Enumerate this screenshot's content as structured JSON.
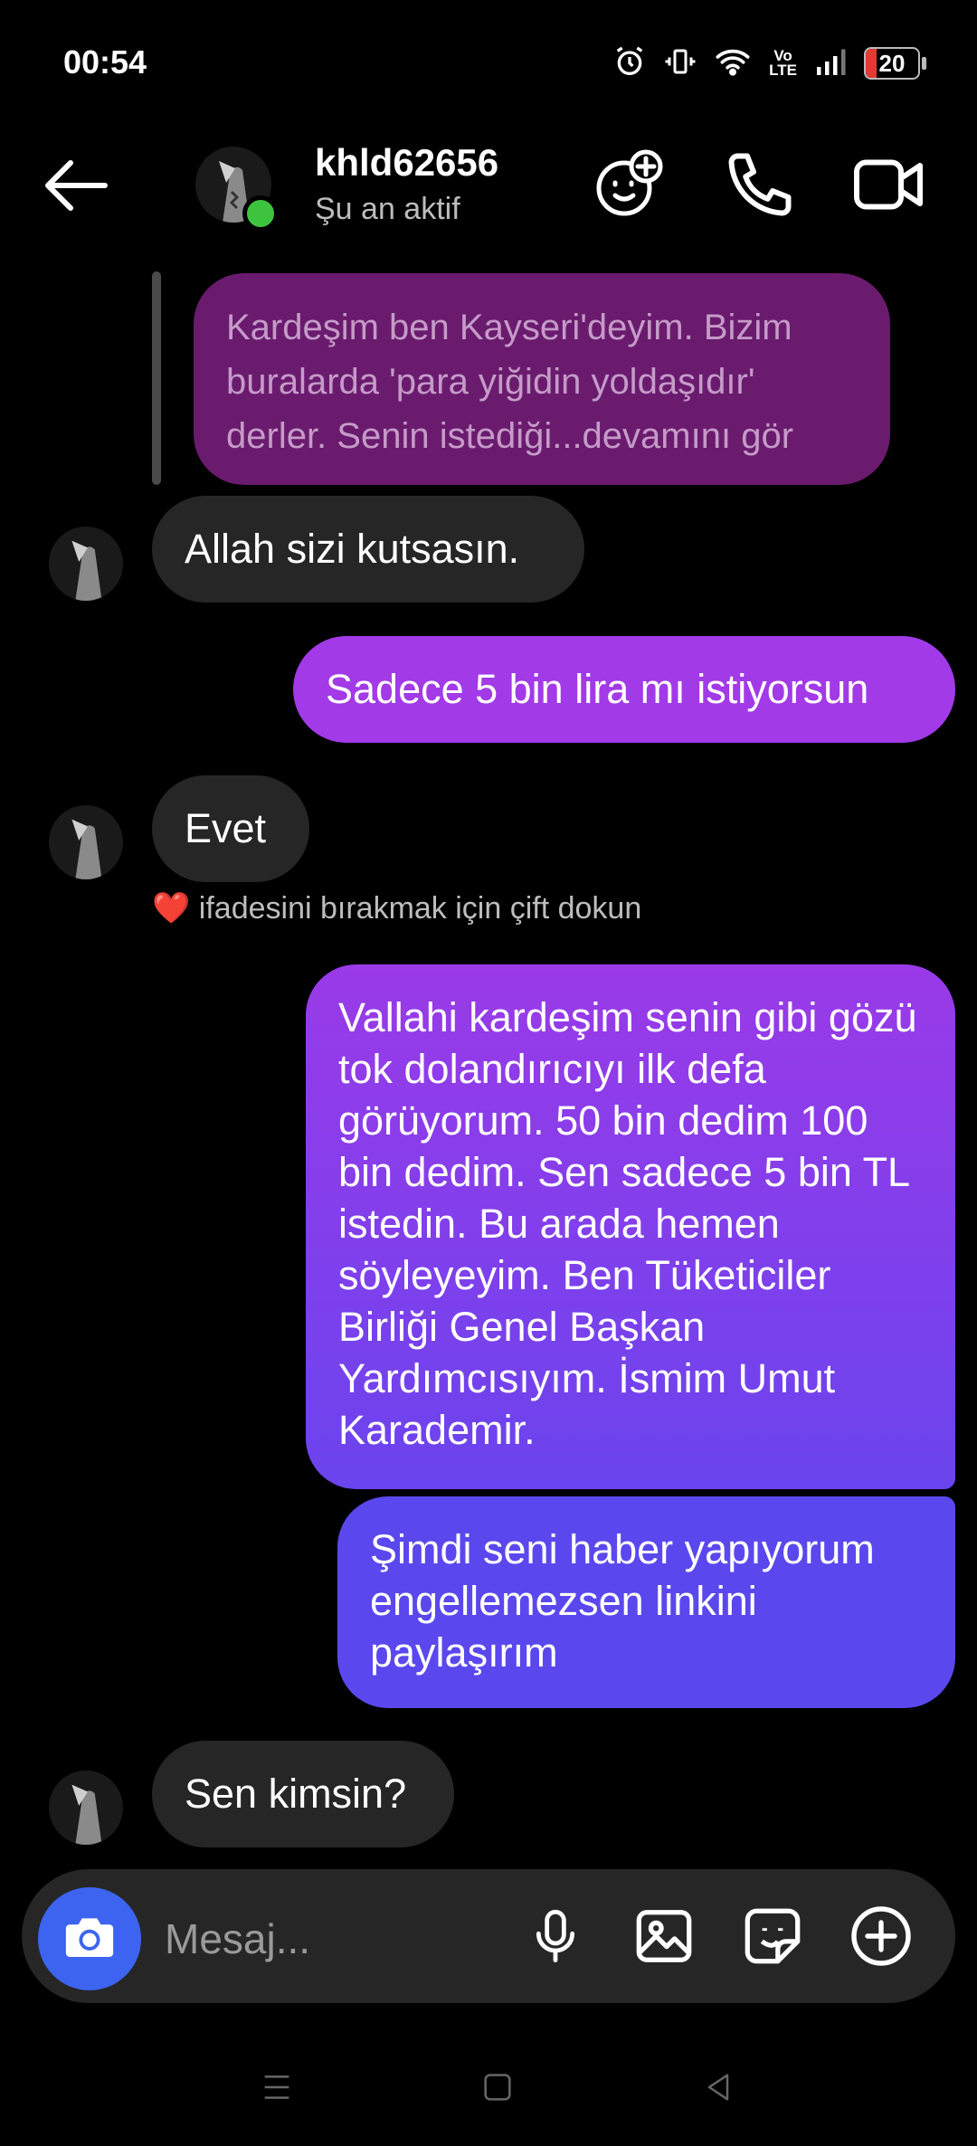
{
  "status_bar": {
    "time": "00:54",
    "network": "Vo\nLTE",
    "battery": "20",
    "battery_color": "#e53935"
  },
  "header": {
    "contact_name": "khld62656",
    "contact_status": "Şu an aktif",
    "online_color": "#3ec33e"
  },
  "messages": [
    {
      "from": "them",
      "kind": "reply_preview",
      "text": "Kardeşim ben Kayseri'deyim. Bizim buralarda 'para yiğidin yoldaşıdır' derler. Senin istediği...devamını gör"
    },
    {
      "from": "them",
      "text": "Allah sizi kutsasın."
    },
    {
      "from": "me",
      "text": "Sadece 5 bin lira mı istiyorsun"
    },
    {
      "from": "them",
      "text": "Evet",
      "hint": "ifadesini bırakmak için çift dokun",
      "hint_emoji": "❤️"
    },
    {
      "from": "me",
      "text": "Vallahi kardeşim senin gibi gözü tok dolandırıcıyı ilk defa görüyorum. 50 bin dedim 100 bin dedim. Sen sadece 5 bin TL istedin. Bu arada hemen söyleyeyim. Ben Tüketiciler Birliği Genel Başkan Yardımcısıyım. İsmim Umut Karademir."
    },
    {
      "from": "me",
      "text": "Şimdi seni haber yapıyorum engellemezsen linkini paylaşırım"
    },
    {
      "from": "them",
      "text": "Sen kimsin?"
    }
  ],
  "composer": {
    "placeholder": "Mesaj...",
    "accent": "#3c64f0"
  },
  "icons": {
    "header": [
      "back-arrow-icon",
      "avatar-sticker-icon",
      "phone-icon",
      "video-camera-icon"
    ],
    "composer": [
      "camera-icon",
      "microphone-icon",
      "gallery-icon",
      "sticker-icon",
      "plus-circle-icon"
    ],
    "nav": [
      "menu-icon",
      "home-square-icon",
      "back-triangle-icon"
    ]
  },
  "colors": {
    "received_bubble": "#262626",
    "sent_gradient_top": "#a23ae8",
    "sent_gradient_bottom": "#5a44ee",
    "reply_preview": "#6a1b6e"
  }
}
